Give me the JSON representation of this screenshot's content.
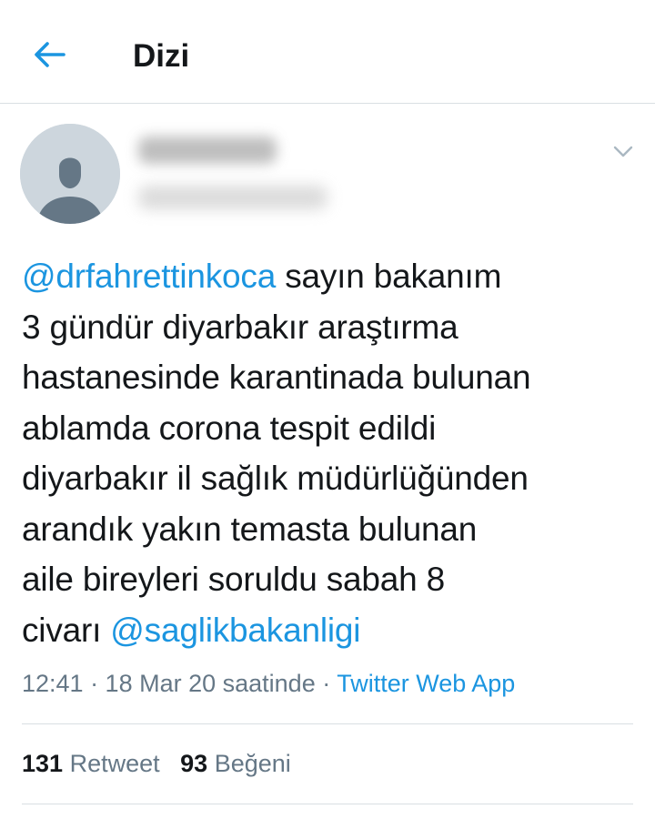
{
  "header": {
    "title": "Dizi"
  },
  "icons": {
    "back": "back-arrow-icon",
    "caret": "chevron-down-icon",
    "avatar": "default-avatar-icon"
  },
  "colors": {
    "accent": "#1b95e0",
    "text": "#14171a",
    "secondary": "#657786",
    "divider": "#d9dfe3"
  },
  "tweet": {
    "lines": [
      {
        "mention": "@drfahrettinkoca",
        "text": " sayın bakanım"
      },
      {
        "text": "3 gündür diyarbakır araştırma"
      },
      {
        "text": "hastanesinde karantinada bulunan"
      },
      {
        "text": "ablamda corona tespit edildi"
      },
      {
        "text": "diyarbakır il sağlık müdürlüğünden"
      },
      {
        "text": "arandık yakın temasta bulunan"
      },
      {
        "text": "aile bireyleri soruldu sabah 8"
      },
      {
        "text": "civarı ",
        "mention": "@saglikbakanligi"
      }
    ],
    "timestamp": "12:41 · 18 Mar 20 saatinde · ",
    "source": "Twitter Web App"
  },
  "stats": {
    "retweets_count": "131",
    "retweets_label": " Retweet",
    "likes_count": "93",
    "likes_label": " Beğeni"
  }
}
